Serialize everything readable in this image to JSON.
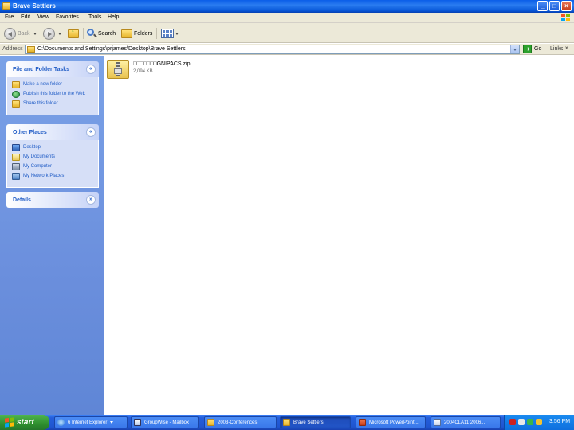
{
  "window": {
    "title": "Brave Settlers",
    "controls": {
      "minimize": "_",
      "maximize": "□",
      "close": "×"
    }
  },
  "menu": [
    "File",
    "Edit",
    "View",
    "Favorites",
    "Tools",
    "Help"
  ],
  "toolbar": {
    "back_label": "Back",
    "search_label": "Search",
    "folders_label": "Folders"
  },
  "address": {
    "label": "Address",
    "path": "C:\\Documents and Settings\\prjames\\Desktop\\Brave Settlers",
    "go_label": "Go",
    "links_label": "Links",
    "links_chevron": "»"
  },
  "sidebar": {
    "file_tasks": {
      "title": "File and Folder Tasks",
      "chevron": "«",
      "items": [
        {
          "label": "Make a new folder",
          "icon": "folder-icon"
        },
        {
          "label": "Publish this folder to the Web",
          "icon": "globe-icon"
        },
        {
          "label": "Share this folder",
          "icon": "share-folder-icon"
        }
      ]
    },
    "other_places": {
      "title": "Other Places",
      "chevron": "«",
      "items": [
        {
          "label": "Desktop",
          "icon": "desktop-icon"
        },
        {
          "label": "My Documents",
          "icon": "documents-icon"
        },
        {
          "label": "My Computer",
          "icon": "computer-icon"
        },
        {
          "label": "My Network Places",
          "icon": "network-icon"
        }
      ]
    },
    "details": {
      "title": "Details",
      "chevron": "»"
    }
  },
  "files": [
    {
      "name": "□□□□□□□GNIPACS.zip",
      "size": "2,094 KB",
      "icon": "zip-folder-icon"
    }
  ],
  "taskbar": {
    "start_label": "start",
    "buttons": [
      {
        "label": "6 Internet Explorer",
        "icon": "ie-icon",
        "dropdown": true,
        "active": false
      },
      {
        "label": "GroupWise - Mailbox",
        "icon": "groupwise-icon",
        "dropdown": false,
        "active": false
      },
      {
        "label": "2003-Conferences",
        "icon": "folder-icon",
        "dropdown": false,
        "active": false
      },
      {
        "label": "Brave Settlers",
        "icon": "folder-icon",
        "dropdown": false,
        "active": true
      },
      {
        "label": "Microsoft PowerPoint ...",
        "icon": "powerpoint-icon",
        "dropdown": false,
        "active": false
      },
      {
        "label": "2004CLA11 2006...",
        "icon": "document-icon",
        "dropdown": false,
        "active": false
      }
    ],
    "clock": "3:56 PM"
  }
}
